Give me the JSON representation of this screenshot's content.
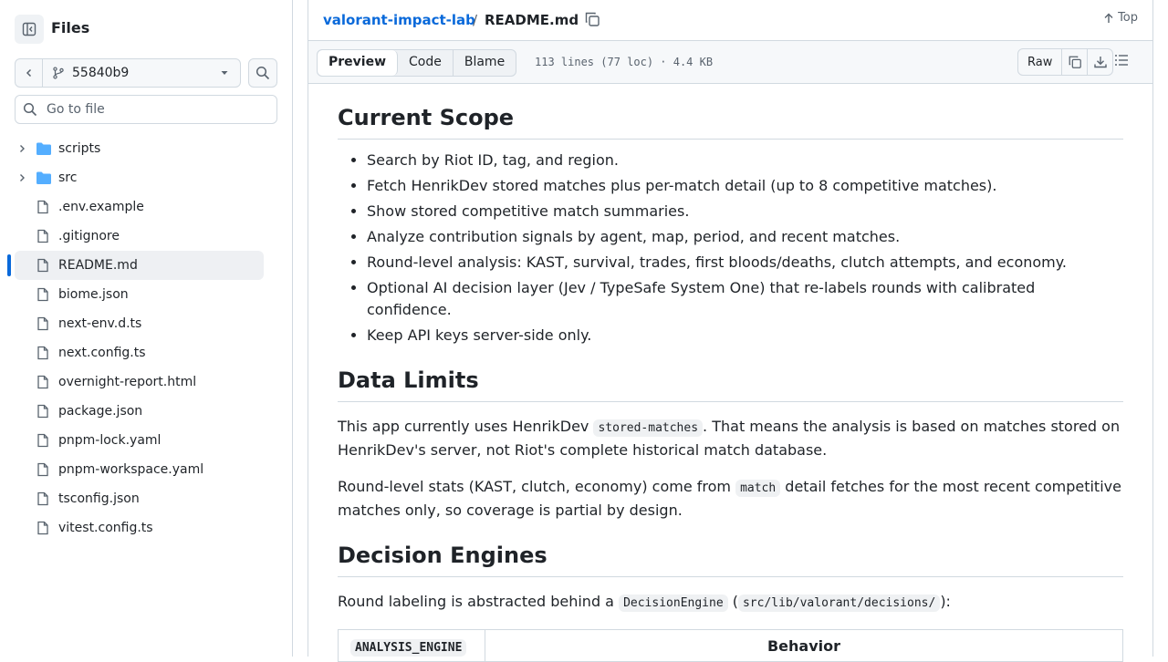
{
  "sidebar": {
    "title": "Files",
    "branch": "55840b9",
    "search_placeholder": "Go to file",
    "items": [
      {
        "label": "scripts",
        "type": "folder"
      },
      {
        "label": "src",
        "type": "folder"
      },
      {
        "label": ".env.example",
        "type": "file"
      },
      {
        "label": ".gitignore",
        "type": "file"
      },
      {
        "label": "README.md",
        "type": "file",
        "active": true
      },
      {
        "label": "biome.json",
        "type": "file"
      },
      {
        "label": "next-env.d.ts",
        "type": "file"
      },
      {
        "label": "next.config.ts",
        "type": "file"
      },
      {
        "label": "overnight-report.html",
        "type": "file"
      },
      {
        "label": "package.json",
        "type": "file"
      },
      {
        "label": "pnpm-lock.yaml",
        "type": "file"
      },
      {
        "label": "pnpm-workspace.yaml",
        "type": "file"
      },
      {
        "label": "tsconfig.json",
        "type": "file"
      },
      {
        "label": "vitest.config.ts",
        "type": "file"
      }
    ]
  },
  "path": {
    "repo": "valorant-impact-lab",
    "separator": "/",
    "file": "README.md",
    "top_label": "Top"
  },
  "file_header": {
    "tabs": [
      "Preview",
      "Code",
      "Blame"
    ],
    "active_tab": "Preview",
    "info": "113 lines (77 loc) · 4.4 KB",
    "raw_label": "Raw"
  },
  "readme": {
    "scope_heading": "Current Scope",
    "scope_items": [
      "Search by Riot ID, tag, and region.",
      "Fetch HenrikDev stored matches plus per-match detail (up to 8 competitive matches).",
      "Show stored competitive match summaries.",
      "Analyze contribution signals by agent, map, period, and recent matches.",
      "Round-level analysis: KAST, survival, trades, first bloods/deaths, clutch attempts, and economy.",
      "Optional AI decision layer (Jev / TypeSafe System One) that re-labels rounds with calibrated confidence.",
      "Keep API keys server-side only."
    ],
    "limits_heading": "Data Limits",
    "limits_p1": {
      "before": "This app currently uses HenrikDev ",
      "code": "stored-matches",
      "after": ". That means the analysis is based on matches stored on HenrikDev's server, not Riot's complete historical match database."
    },
    "limits_p2": {
      "before": "Round-level stats (KAST, clutch, economy) come from ",
      "code": "match",
      "after": " detail fetches for the most recent competitive matches only, so coverage is partial by design."
    },
    "engines_heading": "Decision Engines",
    "engines_p": {
      "before": "Round labeling is abstracted behind a ",
      "code1": "DecisionEngine",
      "middle": " (",
      "code2": "src/lib/valorant/decisions/",
      "after": "):"
    },
    "table_headers": [
      "ANALYSIS_ENGINE",
      "Behavior"
    ]
  },
  "colors": {
    "link": "#0969da",
    "border": "#d1d9e0",
    "active_bar": "#0969da"
  }
}
